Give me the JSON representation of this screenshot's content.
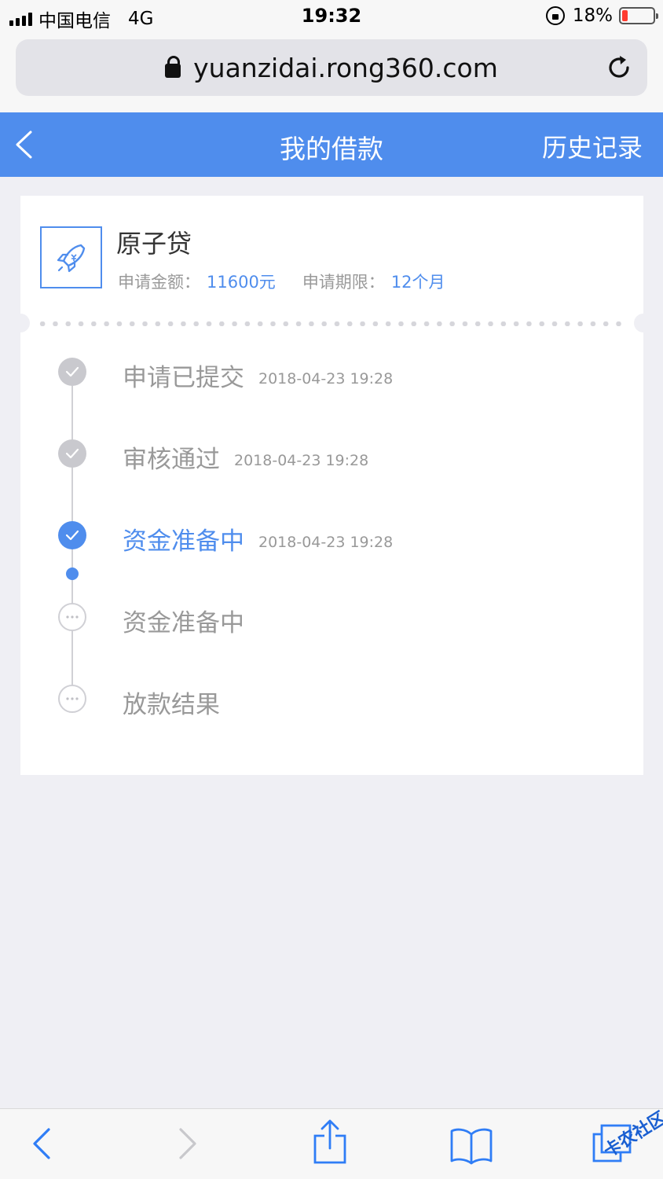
{
  "status_bar": {
    "carrier": "中国电信",
    "network": "4G",
    "time": "19:32",
    "battery": "18%",
    "battery_level": 0.18
  },
  "browser": {
    "url": "yuanzidai.rong360.com"
  },
  "header": {
    "title": "我的借款",
    "history_label": "历史记录",
    "accent_color": "#4f8ded"
  },
  "loan": {
    "product_name": "原子贷",
    "amount_label": "申请金额：",
    "amount_value": "11600元",
    "term_label": "申请期限：",
    "term_value": "12个月"
  },
  "timeline": [
    {
      "label": "申请已提交",
      "time": "2018-04-23 19:28",
      "state": "done"
    },
    {
      "label": "审核通过",
      "time": "2018-04-23 19:28",
      "state": "done"
    },
    {
      "label": "资金准备中",
      "time": "2018-04-23 19:28",
      "state": "active"
    },
    {
      "label": "资金准备中",
      "time": "",
      "state": "pending"
    },
    {
      "label": "放款结果",
      "time": "",
      "state": "pending"
    }
  ],
  "toolbar": {
    "icons": [
      "back-icon",
      "forward-icon",
      "share-icon",
      "bookmarks-icon",
      "tabs-icon"
    ]
  },
  "watermark": "卡农社区"
}
